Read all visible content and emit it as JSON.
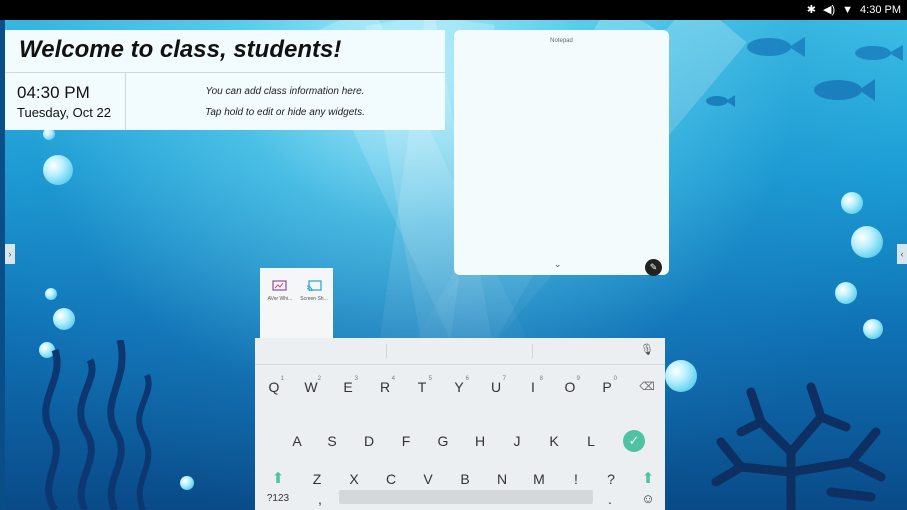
{
  "status_bar": {
    "time": "4:30 PM",
    "icons": [
      "bluetooth-icon",
      "volume-icon",
      "wifi-icon"
    ]
  },
  "welcome": {
    "title": "Welcome to class, students!"
  },
  "clock": {
    "time": "04:30 PM",
    "date": "Tuesday, Oct 22"
  },
  "info": {
    "line1": "You can add class information here.",
    "line2": "Tap hold to edit or hide any widgets."
  },
  "notepad": {
    "title": "Notepad"
  },
  "apps": [
    {
      "label": "AVer Whi..."
    },
    {
      "label": "Screen Sh..."
    }
  ],
  "keyboard": {
    "row1": [
      "Q",
      "W",
      "E",
      "R",
      "T",
      "Y",
      "U",
      "I",
      "O",
      "P"
    ],
    "row1_hints": [
      "1",
      "2",
      "3",
      "4",
      "5",
      "6",
      "7",
      "8",
      "9",
      "0"
    ],
    "row2": [
      "A",
      "S",
      "D",
      "F",
      "G",
      "H",
      "J",
      "K",
      "L"
    ],
    "row3": [
      "Z",
      "X",
      "C",
      "V",
      "B",
      "N",
      "M",
      "!",
      "?"
    ],
    "symbols_label": "?123",
    "comma": ",",
    "period": "."
  },
  "colors": {
    "ocean_top": "#3cc0e6",
    "ocean_bottom": "#0a4a88",
    "enter_key": "#4ec3a4",
    "panel": "#f2fbfd"
  }
}
